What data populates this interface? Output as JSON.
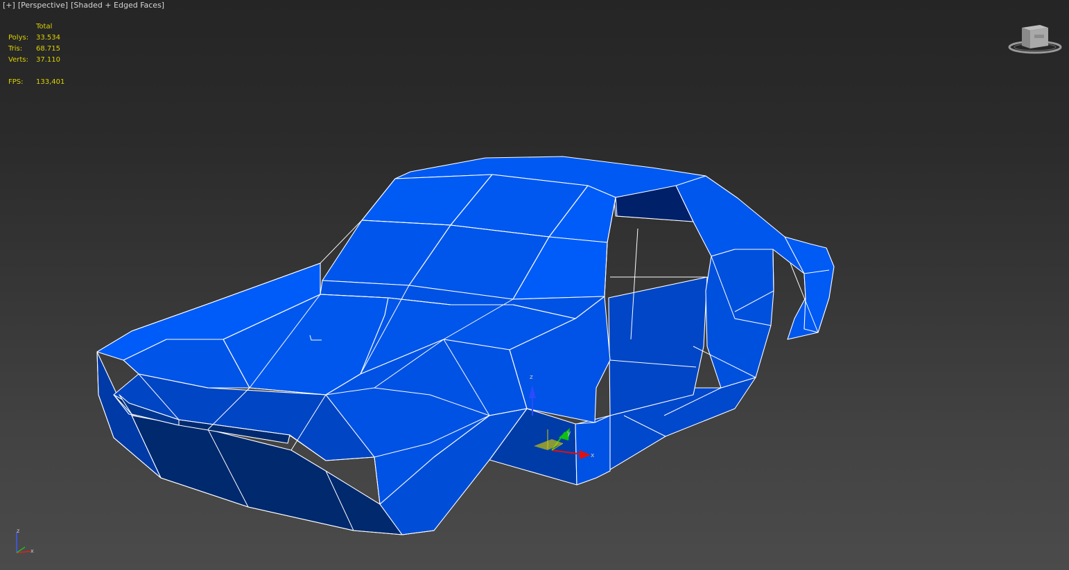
{
  "viewport": {
    "plus": "[+]",
    "view": "[Perspective]",
    "shading": "[Shaded + Edged Faces]"
  },
  "stats": {
    "header": "Total",
    "polys_label": "Polys:",
    "polys_value": "33.534",
    "tris_label": "Tris:",
    "tris_value": "68.715",
    "verts_label": "Verts:",
    "verts_value": "37.110",
    "fps_label": "FPS:",
    "fps_value": "133,401"
  },
  "gizmo": {
    "z_label": "z",
    "x_label": "x",
    "y_label": "y"
  },
  "corner_axis": {
    "z_label": "z",
    "x_label": "x"
  },
  "colors": {
    "mesh_light": "#0055ee",
    "mesh_mid": "#0048cc",
    "mesh_dark": "#002a70",
    "edge": "#ffffff",
    "stats_text": "#ddd400"
  }
}
